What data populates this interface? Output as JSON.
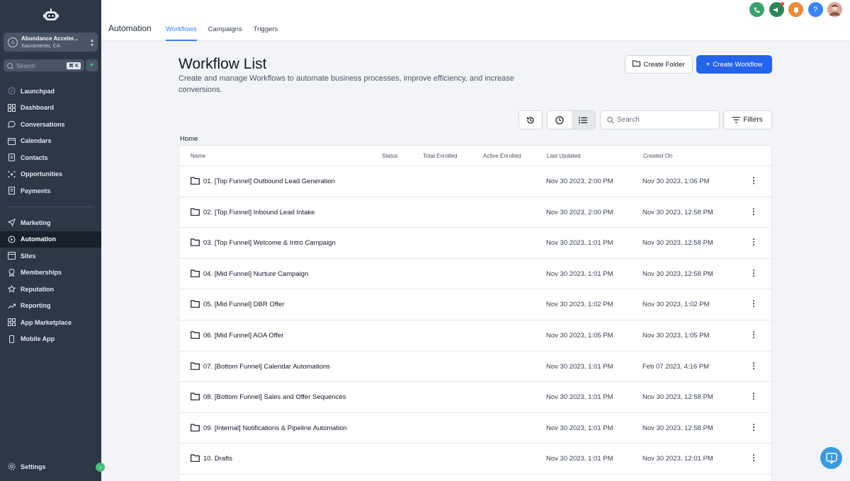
{
  "sidebar": {
    "account": {
      "name": "Abundance Acceler...",
      "location": "Sacramento, CA"
    },
    "search": {
      "placeholder": "Search",
      "shortcut": "⌘ K"
    },
    "items": [
      {
        "label": "Launchpad",
        "icon": "rocket-icon"
      },
      {
        "label": "Dashboard",
        "icon": "grid-icon"
      },
      {
        "label": "Conversations",
        "icon": "chat-icon"
      },
      {
        "label": "Calendars",
        "icon": "calendar-icon"
      },
      {
        "label": "Contacts",
        "icon": "contacts-icon"
      },
      {
        "label": "Opportunities",
        "icon": "opportunities-icon"
      },
      {
        "label": "Payments",
        "icon": "payments-icon"
      }
    ],
    "items2": [
      {
        "label": "Marketing",
        "icon": "send-icon"
      },
      {
        "label": "Automation",
        "icon": "automation-icon",
        "active": true
      },
      {
        "label": "Sites",
        "icon": "sites-icon"
      },
      {
        "label": "Memberships",
        "icon": "badge-icon"
      },
      {
        "label": "Reputation",
        "icon": "star-icon"
      },
      {
        "label": "Reporting",
        "icon": "trend-icon"
      },
      {
        "label": "App Marketplace",
        "icon": "apps-icon"
      },
      {
        "label": "Mobile App",
        "icon": "phone-icon"
      }
    ],
    "settings_label": "Settings"
  },
  "header": {
    "title": "Automation",
    "tabs": [
      {
        "label": "Workflows",
        "active": true
      },
      {
        "label": "Campaigns"
      },
      {
        "label": "Triggers"
      }
    ],
    "help_label": "?"
  },
  "main": {
    "title": "Workflow List",
    "description": "Create and manage Workflows to automate business processes, improve efficiency, and increase conversions.",
    "create_folder_label": "Create Folder",
    "create_workflow_label": "Create Workflow",
    "search_placeholder": "Search",
    "filters_label": "Filters",
    "breadcrumb": "Home"
  },
  "table": {
    "columns": [
      "Name",
      "Status",
      "Total Enrolled",
      "Active Enrolled",
      "Last Updated",
      "Created On"
    ],
    "rows": [
      {
        "name": "01. [Top Funnel] Outbound Lead Generation",
        "updated": "Nov 30 2023, 2:00 PM",
        "created": "Nov 30 2023, 1:06 PM"
      },
      {
        "name": "02. [Top Funnel] Inbound Lead Intake",
        "updated": "Nov 30 2023, 2:00 PM",
        "created": "Nov 30 2023, 12:58 PM"
      },
      {
        "name": "03. [Top Funnel] Welcome & Intro Campaign",
        "updated": "Nov 30 2023, 1:01 PM",
        "created": "Nov 30 2023, 12:58 PM"
      },
      {
        "name": "04. [Mid Funnel] Nurture Campaign",
        "updated": "Nov 30 2023, 1:01 PM",
        "created": "Nov 30 2023, 12:58 PM"
      },
      {
        "name": "05. [Mid Funnel] DBR Offer",
        "updated": "Nov 30 2023, 1:02 PM",
        "created": "Nov 30 2023, 1:02 PM"
      },
      {
        "name": "06. [Mid Funnel] AOA Offer",
        "updated": "Nov 30 2023, 1:05 PM",
        "created": "Nov 30 2023, 1:05 PM"
      },
      {
        "name": "07. [Bottom Funnel] Calendar Automations",
        "updated": "Nov 30 2023, 1:01 PM",
        "created": "Feb 07 2023, 4:16 PM"
      },
      {
        "name": "08. [Bottom Funnel] Sales and Offer Sequences",
        "updated": "Nov 30 2023, 1:01 PM",
        "created": "Nov 30 2023, 12:58 PM"
      },
      {
        "name": "09. [Internal] Notifications & Pipeline Automation",
        "updated": "Nov 30 2023, 1:01 PM",
        "created": "Nov 30 2023, 12:58 PM"
      },
      {
        "name": "10. Drafts",
        "updated": "Nov 30 2023, 1:01 PM",
        "created": "Nov 30 2023, 12:01 PM"
      }
    ]
  },
  "colors": {
    "sidebar_bg": "#2d3748",
    "primary": "#2563eb",
    "tab_active": "#3b82f6",
    "phone_green": "#38a169",
    "megaphone_teal": "#2f855a",
    "bell_orange": "#ed8936",
    "help_blue": "#3b82f6"
  }
}
